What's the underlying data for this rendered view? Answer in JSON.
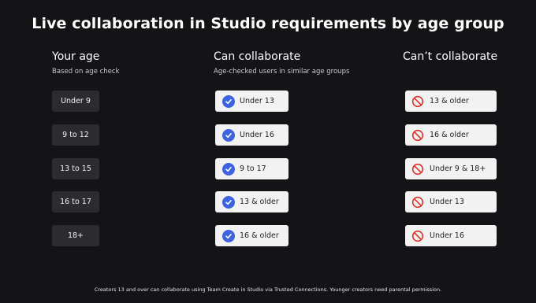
{
  "title": "Live collaboration in Studio requirements by age group",
  "columns": {
    "age": {
      "heading": "Your age",
      "subheading": "Based on age check"
    },
    "can": {
      "heading": "Can collaborate",
      "subheading": "Age-checked users in similar age groups"
    },
    "cant": {
      "heading": "Can’t collaborate",
      "subheading": ""
    }
  },
  "rows": [
    {
      "age": "Under 9",
      "can": "Under 13",
      "cant": "13 & older"
    },
    {
      "age": "9 to 12",
      "can": "Under 16",
      "cant": "16 & older"
    },
    {
      "age": "13 to 15",
      "can": "9 to 17",
      "cant": "Under 9 & 18+"
    },
    {
      "age": "16 to 17",
      "can": "13 & older",
      "cant": "Under 13"
    },
    {
      "age": "18+",
      "can": "16 & older",
      "cant": "Under 16"
    }
  ],
  "icons": {
    "can": "check-circle-icon",
    "cant": "prohibited-icon"
  },
  "colors": {
    "background": "#141416",
    "check": "#3d63e0",
    "prohibited": "#d9312b",
    "pill_dark": "#2b2b30",
    "pill_light": "#f2f2f2"
  },
  "footnote": "Creators 13 and over can collaborate using Team Create in Studio via Trusted Connections. Younger creators need parental permission."
}
